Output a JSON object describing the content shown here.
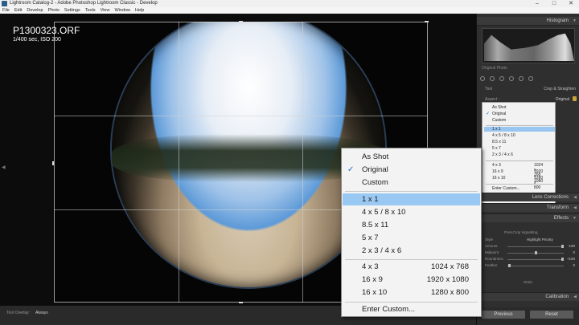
{
  "window": {
    "title": "Lightroom Catalog-2 - Adobe Photoshop Lightroom Classic - Develop",
    "minimize": "–",
    "maximize": "□",
    "close": "✕"
  },
  "menu": [
    "File",
    "Edit",
    "Develop",
    "Photo",
    "Settings",
    "Tools",
    "View",
    "Window",
    "Help"
  ],
  "photo": {
    "filename": "P1300323.ORF",
    "meta": "1/400 sec, ISO 200"
  },
  "toolbar": {
    "tool_overlay_label": "Tool Overlay :",
    "tool_overlay_value": "Always"
  },
  "right_panel": {
    "histogram": "Histogram",
    "original_photo": "Original Photo",
    "tool_label": "Tool",
    "crop_straighten": "Crop & Straighten",
    "aspect_label": "Aspect :",
    "aspect_value": "Original",
    "lens_corrections": "Lens Corrections",
    "transform": "Transform",
    "effects": "Effects",
    "post_crop_vignetting": "Post-Crop Vignetting",
    "style_label": "Style",
    "style_value": "Highlight Priority",
    "sliders": [
      {
        "label": "Amount",
        "value": "-100",
        "pos": 0.97
      },
      {
        "label": "Midpoint",
        "value": "0",
        "pos": 0.5
      },
      {
        "label": "Roundness",
        "value": "+100",
        "pos": 0.97
      },
      {
        "label": "Feather",
        "value": "0",
        "pos": 0.03
      }
    ],
    "grain": "Grain",
    "calibration": "Calibration",
    "previous_button": "Previous",
    "reset_button": "Reset"
  },
  "mini_menu": {
    "group1": [
      "As Shot",
      "Original",
      "Custom"
    ],
    "group2": [
      "1 x 1",
      "4 x 5  /  8 x 10",
      "8.5 x 11",
      "5 x 7",
      "2 x 3  /  4 x 6"
    ],
    "group3": [
      {
        "left": "4 x 3",
        "right": "1024 x 768"
      },
      {
        "left": "16 x 9",
        "right": "1920 x 1080"
      },
      {
        "left": "16 x 10",
        "right": "1280 x 800"
      }
    ],
    "enter_custom": "Enter Custom..."
  },
  "dropdown": {
    "check": "✓",
    "as_shot": "As Shot",
    "original": "Original",
    "custom": "Custom",
    "ratios": [
      "1 x 1",
      "4 x 5  /  8 x 10",
      "8.5 x 11",
      "5 x 7",
      "2 x 3  /  4 x 6"
    ],
    "resolutions": [
      {
        "left": "4 x 3",
        "right": "1024 x 768"
      },
      {
        "left": "16 x 9",
        "right": "1920 x 1080"
      },
      {
        "left": "16 x 10",
        "right": "1280 x 800"
      }
    ],
    "enter_custom": "Enter Custom..."
  },
  "colors": {
    "highlight": "#99c9f2",
    "panel_bg": "#2f2f2f",
    "checkmark": "#1a6fd1"
  }
}
